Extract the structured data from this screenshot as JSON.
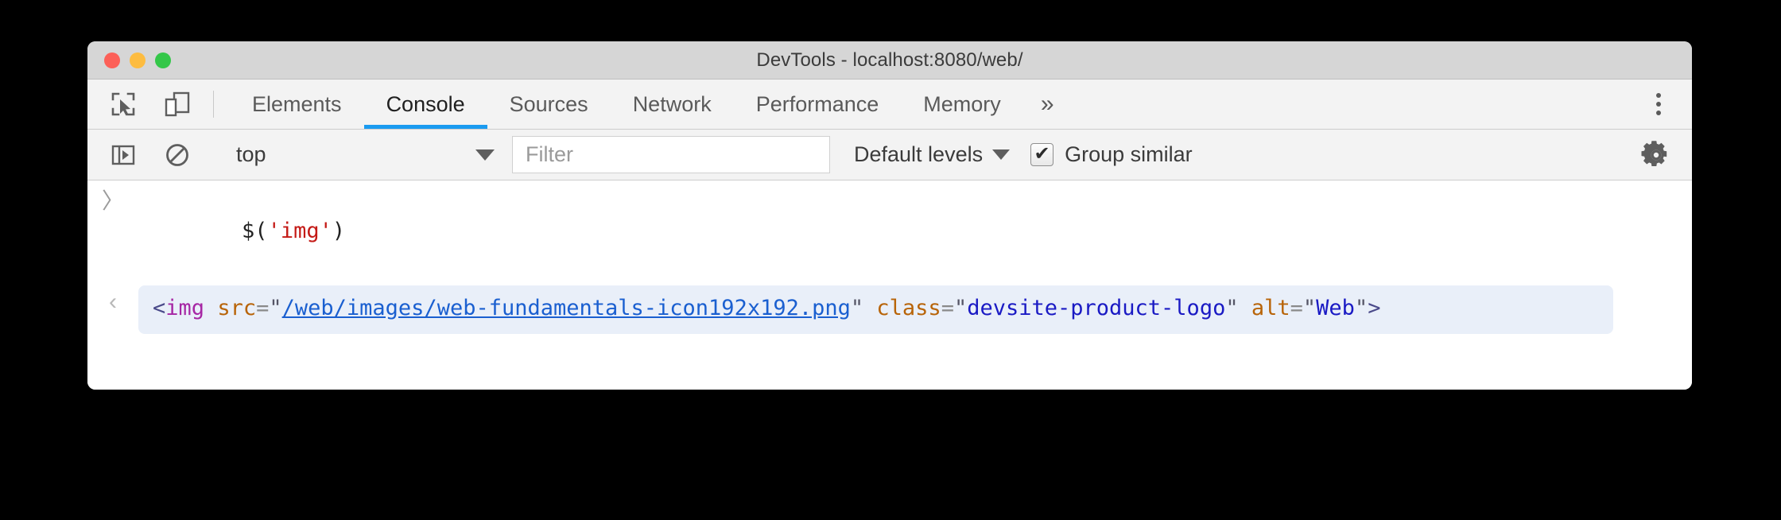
{
  "window": {
    "title": "DevTools - localhost:8080/web/",
    "traffic_lights": [
      {
        "name": "close",
        "color": "#fc6058"
      },
      {
        "name": "minimize",
        "color": "#fdbc40"
      },
      {
        "name": "maximize",
        "color": "#34c749"
      }
    ]
  },
  "toolbar": {
    "inspect_icon": "inspect-element-icon",
    "device_icon": "device-toolbar-icon",
    "more_tabs_label": "»",
    "menu_icon": "kebab-menu-icon"
  },
  "tabs": [
    {
      "label": "Elements",
      "active": false
    },
    {
      "label": "Console",
      "active": true
    },
    {
      "label": "Sources",
      "active": false
    },
    {
      "label": "Network",
      "active": false
    },
    {
      "label": "Performance",
      "active": false
    },
    {
      "label": "Memory",
      "active": false
    }
  ],
  "console_toolbar": {
    "sidebar_icon": "console-sidebar-toggle-icon",
    "clear_icon": "clear-console-icon",
    "context_value": "top",
    "filter_placeholder": "Filter",
    "filter_value": "",
    "levels_label": "Default levels",
    "group_similar_label": "Group similar",
    "group_similar_checked": true,
    "settings_icon": "settings-gear-icon"
  },
  "console": {
    "input_glyph": "〉",
    "result_glyph": "‹",
    "input_line": {
      "full_text": "$('img')",
      "tokens": [
        {
          "text": "$(",
          "type": "punct"
        },
        {
          "text": "'img'",
          "type": "string"
        },
        {
          "text": ")",
          "type": "punct"
        }
      ]
    },
    "result_line": {
      "full_text": "<img src=\"/web/images/web-fundamentals-icon192x192.png\" class=\"devsite-product-logo\" alt=\"Web\">",
      "tokens": [
        {
          "text": "<",
          "type": "tagpunct"
        },
        {
          "text": "img",
          "type": "tag"
        },
        {
          "text": " ",
          "type": "plain"
        },
        {
          "text": "src",
          "type": "attr"
        },
        {
          "text": "=",
          "type": "eq"
        },
        {
          "text": "\"",
          "type": "quote"
        },
        {
          "text": "/web/images/web-fundamentals-icon192x192.png",
          "type": "link"
        },
        {
          "text": "\"",
          "type": "quote"
        },
        {
          "text": " ",
          "type": "plain"
        },
        {
          "text": "class",
          "type": "attr"
        },
        {
          "text": "=",
          "type": "eq"
        },
        {
          "text": "\"",
          "type": "quote"
        },
        {
          "text": "devsite-product-logo",
          "type": "value"
        },
        {
          "text": "\"",
          "type": "quote"
        },
        {
          "text": " ",
          "type": "plain"
        },
        {
          "text": "alt",
          "type": "attr"
        },
        {
          "text": "=",
          "type": "eq"
        },
        {
          "text": "\"",
          "type": "quote"
        },
        {
          "text": "Web",
          "type": "value"
        },
        {
          "text": "\"",
          "type": "quote"
        },
        {
          "text": ">",
          "type": "tagpunct"
        }
      ]
    }
  },
  "colors": {
    "accent": "#1a9bf0",
    "titlebar": "#d6d6d6",
    "toolbar": "#f3f3f3",
    "result_bubble": "#e9eff9",
    "string": "#c41a16",
    "tag": "#a626a4",
    "attr": "#b86409",
    "value": "#1a1ac4",
    "link": "#1a5fd0"
  }
}
